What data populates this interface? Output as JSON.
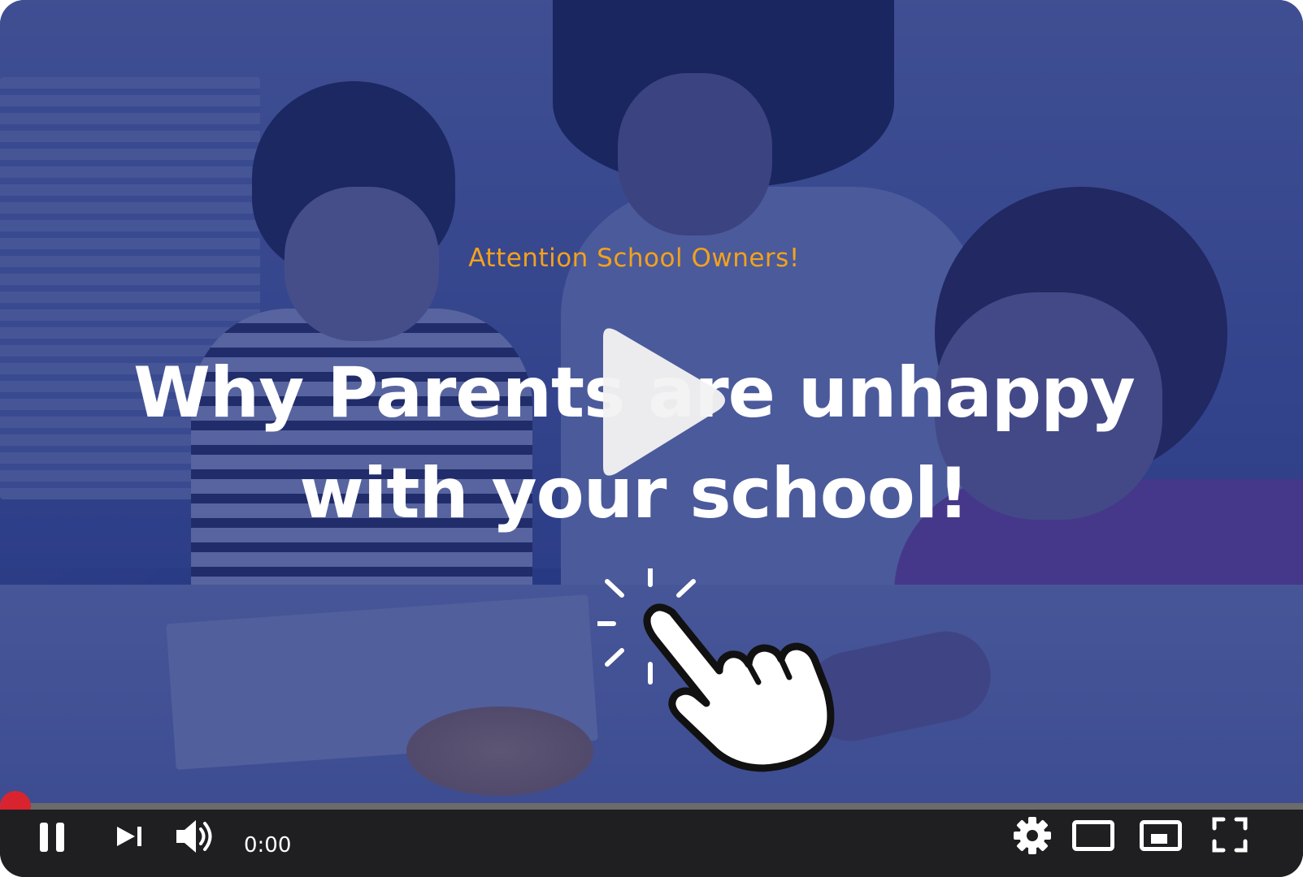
{
  "video": {
    "kicker": "Attention School Owners!",
    "headline_line1": "Why Parents are unhappy",
    "headline_line2": "with your school!",
    "overlay_color": "#1c2c78"
  },
  "player": {
    "time_display": "0:00",
    "progress_fraction": 0.0,
    "progress_color": "#e62117",
    "scrub_color": "#d9242f",
    "controls": {
      "pause": "pause-icon",
      "next": "next-icon",
      "volume": "volume-icon",
      "settings": "gear-icon",
      "theater": "theater-mode-icon",
      "miniplayer": "miniplayer-icon",
      "fullscreen": "fullscreen-icon"
    }
  },
  "overlay_graphics": {
    "center_play": "play-icon",
    "hand_pointer": "hand-pointer-icon"
  }
}
